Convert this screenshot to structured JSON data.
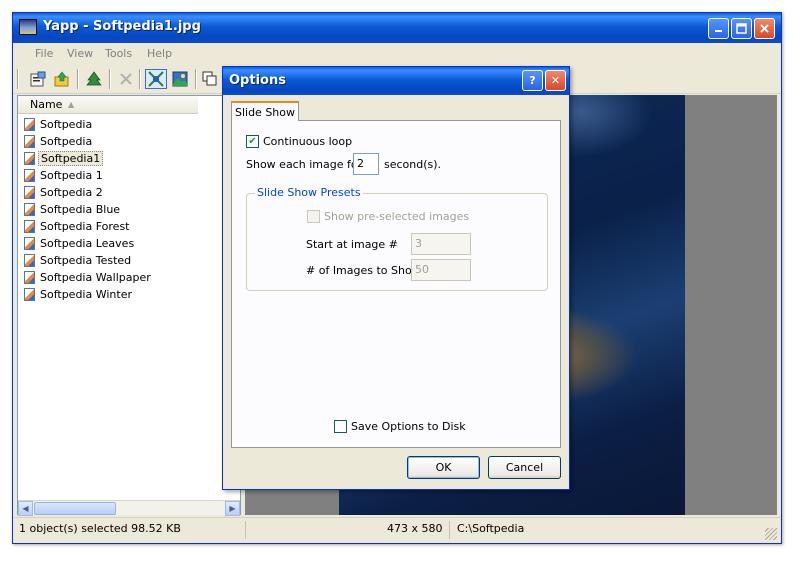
{
  "window": {
    "title": "Yapp - Softpedia1.jpg",
    "icon": "landscape-app-icon",
    "controls": [
      "minimize-icon",
      "maximize-icon",
      "close-icon"
    ]
  },
  "menu": {
    "items": [
      "File",
      "View",
      "Tools",
      "Help"
    ]
  },
  "toolbar": {
    "buttons": [
      "properties-icon",
      "up-folder-icon",
      "tree-icon",
      "delete-icon",
      "fit-icon",
      "image-icon",
      "copy-icon"
    ]
  },
  "file_list": {
    "header": "Name",
    "items": [
      {
        "label": "Softpedia",
        "selected": false
      },
      {
        "label": "Softpedia",
        "selected": false
      },
      {
        "label": "Softpedia1",
        "selected": true
      },
      {
        "label": "Softpedia 1",
        "selected": false
      },
      {
        "label": "Softpedia 2",
        "selected": false
      },
      {
        "label": "Softpedia Blue",
        "selected": false
      },
      {
        "label": "Softpedia Forest",
        "selected": false
      },
      {
        "label": "Softpedia Leaves",
        "selected": false
      },
      {
        "label": "Softpedia Tested",
        "selected": false
      },
      {
        "label": "Softpedia Wallpaper",
        "selected": false
      },
      {
        "label": "Softpedia Winter",
        "selected": false
      }
    ]
  },
  "status": {
    "selection": "1 object(s) selected 98.52 KB",
    "dimensions": "473 x 580",
    "path": "C:\\Softpedia"
  },
  "dialog": {
    "title": "Options",
    "help_glyph": "?",
    "close_glyph": "✕",
    "tab": "Slide Show",
    "continuous_loop": {
      "label": "Continuous loop",
      "checked": true
    },
    "show_each": {
      "prefix": "Show each image for",
      "value": "2",
      "suffix": "second(s)."
    },
    "presets": {
      "title": "Slide Show Presets",
      "show_preselected": {
        "label": "Show pre-selected images",
        "checked": false
      },
      "start_at": {
        "label": "Start at image #",
        "value": "3"
      },
      "count": {
        "label": "# of Images to Show",
        "value": "50"
      }
    },
    "save_options": {
      "label": "Save Options to Disk",
      "checked": false
    },
    "ok_label": "OK",
    "cancel_label": "Cancel"
  },
  "colors": {
    "titlebar": "#0a5fe0",
    "window_bg": "#ece9d8",
    "group_title": "#0046d5"
  }
}
